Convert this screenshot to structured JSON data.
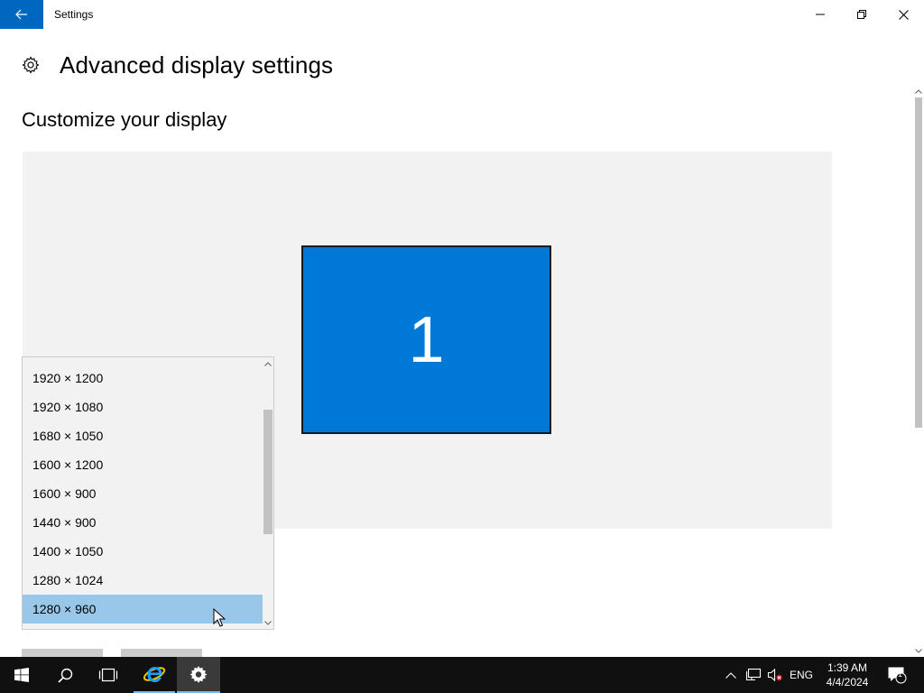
{
  "window": {
    "title": "Settings",
    "back_icon": "arrow-left-icon",
    "controls": [
      "minimize-icon",
      "restore-icon",
      "close-icon"
    ]
  },
  "header": {
    "icon": "gear-icon",
    "title": "Advanced display settings"
  },
  "section": {
    "title": "Customize your display"
  },
  "preview": {
    "monitor_label": "1",
    "monitor_color": "#0078d7"
  },
  "resolution_dropdown": {
    "options": [
      "1920 × 1200",
      "1920 × 1080",
      "1680 × 1050",
      "1600 × 1200",
      "1600 × 900",
      "1440 × 900",
      "1400 × 1050",
      "1280 × 1024",
      "1280 × 960"
    ],
    "highlighted": "1280 × 960",
    "highlight_color": "#99c7ea"
  },
  "taskbar": {
    "apps": [
      "windows-start-icon",
      "search-icon",
      "task-view-icon",
      "internet-explorer-icon",
      "settings-gear-icon"
    ],
    "tray": {
      "language": "ENG",
      "time": "1:39 AM",
      "date": "4/4/2024",
      "notification_count": "1"
    }
  },
  "colors": {
    "accent": "#0067c0",
    "taskbar": "#101010"
  }
}
